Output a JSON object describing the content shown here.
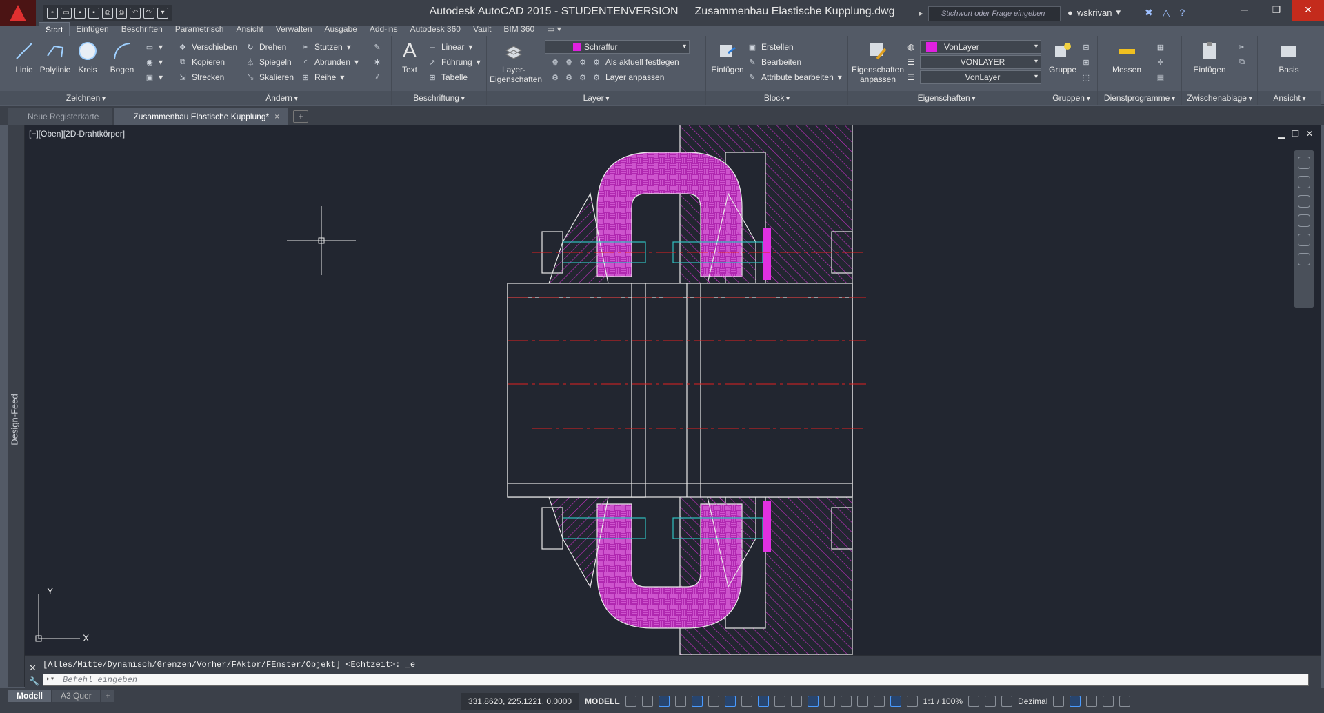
{
  "titlebar": {
    "app": "Autodesk AutoCAD 2015 - STUDENTENVERSION",
    "file": "Zusammenbau Elastische Kupplung.dwg",
    "search_placeholder": "Stichwort oder Frage eingeben",
    "user": "wskrivan"
  },
  "ribbon_tabs": [
    "Start",
    "Einfügen",
    "Beschriften",
    "Parametrisch",
    "Ansicht",
    "Verwalten",
    "Ausgabe",
    "Add-ins",
    "Autodesk 360",
    "Vault",
    "BIM 360"
  ],
  "ribbon": {
    "zeichnen": {
      "title": "Zeichnen",
      "linie": "Linie",
      "polylinie": "Polylinie",
      "kreis": "Kreis",
      "bogen": "Bogen"
    },
    "aendern": {
      "title": "Ändern",
      "verschieben": "Verschieben",
      "drehen": "Drehen",
      "stutzen": "Stutzen",
      "kopieren": "Kopieren",
      "spiegeln": "Spiegeln",
      "abrunden": "Abrunden",
      "strecken": "Strecken",
      "skalieren": "Skalieren",
      "reihe": "Reihe"
    },
    "beschriftung": {
      "title": "Beschriftung",
      "text": "Text",
      "linear": "Linear",
      "fuehrung": "Führung",
      "tabelle": "Tabelle"
    },
    "layer": {
      "title": "Layer",
      "eigenschaften": "Layer-Eigenschaften",
      "current": "Schraffur",
      "aktuell": "Als aktuell festlegen",
      "anpassen": "Layer anpassen"
    },
    "block": {
      "title": "Block",
      "einfuegen": "Einfügen",
      "erstellen": "Erstellen",
      "bearbeiten": "Bearbeiten",
      "attribute": "Attribute bearbeiten"
    },
    "eigenschaften": {
      "title": "Eigenschaften",
      "anpassen": "Eigenschaften anpassen",
      "color": "VonLayer",
      "linetype": "VONLAYER",
      "lineweight": "VonLayer"
    },
    "gruppen": {
      "title": "Gruppen",
      "gruppe": "Gruppe"
    },
    "dienstprogramme": {
      "title": "Dienstprogramme",
      "messen": "Messen"
    },
    "zwischenablage": {
      "title": "Zwischenablage",
      "einfuegen": "Einfügen"
    },
    "ansicht": {
      "title": "Ansicht",
      "basis": "Basis"
    }
  },
  "doc_tabs": {
    "new": "Neue Registerkarte",
    "active": "Zusammenbau Elastische Kupplung*",
    "close": "×",
    "plus": "+"
  },
  "viewport": {
    "label": "[−][Oben][2D-Drahtkörper]",
    "ucs_x": "X",
    "ucs_y": "Y"
  },
  "design_feed": "Design-Feed",
  "command": {
    "history": "[Alles/Mitte/Dynamisch/Grenzen/Vorher/FAktor/FEnster/Objekt] <Echtzeit>: _e",
    "placeholder": "Befehl eingeben"
  },
  "layout_tabs": [
    "Modell",
    "A3 Quer"
  ],
  "status": {
    "coords": "331.8620, 225.1221, 0.0000",
    "mode": "MODELL",
    "scale": "1:1 / 100%",
    "units": "Dezimal"
  },
  "colors": {
    "hatch": "#c030c0",
    "bolt": "#30c0c0",
    "center": "#e02020",
    "background": "#222630"
  }
}
